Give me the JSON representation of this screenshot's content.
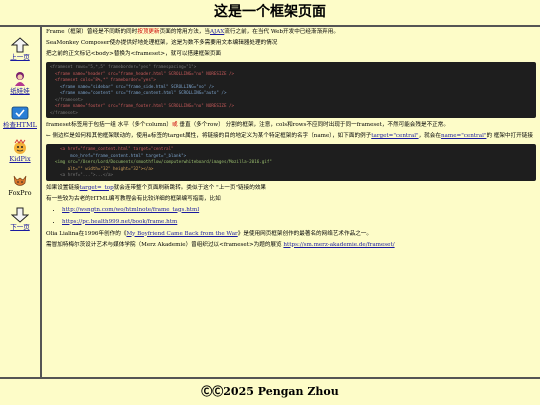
{
  "header": {
    "title": "这是一个框架页面"
  },
  "sidebar": {
    "items": [
      {
        "label": "上一页",
        "icon": "up-arrow-icon"
      },
      {
        "label": "纸娃娃",
        "icon": "paper-doll-icon"
      },
      {
        "label": "检查HTML",
        "icon": "html-check-icon"
      },
      {
        "label": "KidPix",
        "icon": "kidpix-icon"
      },
      {
        "label": "FoxPro",
        "icon": "foxpro-icon"
      },
      {
        "label": "下一页",
        "icon": "down-arrow-icon"
      }
    ]
  },
  "main": {
    "p1": {
      "a": "Frame（框架）曾经是不同断的同时",
      "red": "按顶更新",
      "b": "页面的常用方法，当",
      "link": "AJAX",
      "c": "流行之前，在当代 Web开发中已经渐渐弃用。"
    },
    "p2": "SeaMonkey Composer使办提供好地处理框架，这是为数不多需要用文本编辑器处理的情况",
    "p3": "把之前的正文标记<body>替换为<frameset>，就可以搭建框架页面",
    "code1": [
      "<frameset rows=\"5,*,5\" frameborder=\"yes\" framespacing=\"1\">",
      "  <frame name=\"header\" src=\"frame_header.html\" SCROLLING=\"no\" NORESIZE />",
      "  <frameset cols=\"8%,*\" frameborder=\"yes\">",
      "    <frame name=\"sidebar\" src=\"frame_side.html\" SCROLLING=\"no\" />",
      "    <frame name=\"content\" src=\"frame_content.html\" SCROLLING=\"auto\" />",
      "  </frameset>",
      "  <frame name=\"footer\" src=\"frame_footer.html\" SCROLLING=\"no\" NORESIZE />",
      "</frameset>"
    ],
    "p4": {
      "a": "frameset标签用于包括一组 水平（多个column）",
      "red": "或",
      "b": " 垂直（多个row） 分割的框架，注意，cols和rows不应同时出现于同一frameset，不然可能会残是不正常。"
    },
    "p5": {
      "a": "← 侧边栏是如何和其他框架联动的，使用a标签的target属性，将链接的目的地定义为某个特定框架的名字（name），如下面的例子",
      "link1": "target=\"central\"",
      "b": "，就会在",
      "link2": "name=\"central\"",
      "c": "的 框架中打开链接"
    },
    "code2": [
      "    <a href=\"frame_content.html\" target=\"central\"",
      "        mce_href=\"frame_content.html\" target=\"_blank\">",
      "  <img src=\"/Users/Lord/Documents/smoothflow/computerwhiteboard/images/Mozilla-2016.gif\"",
      "       alt=\"\" width=\"32\" height=\"32\"></a>",
      "    <a href=\"...\">...</a>"
    ],
    "p6": {
      "a": "如果设置链接",
      "link": "target=_top",
      "b": "就会连带整个页面刷新跳转。类似于这个 \"上一页\"链接的效果"
    },
    "p7": "有一些较为古老的HTML编写教程会有比较详细的框架编写指南，比如",
    "links": [
      "http://wsngtn.com/wo/htmlnote/frame_tags.html",
      "https://pc.health999.net/book/frame.htm"
    ],
    "p8": {
      "a": "Olia Lialina在1996年创作的《",
      "link": "My Boyfriend Came Back from the War",
      "b": "》是使用网页框架创作的最著名的网络艺术作品之一。"
    },
    "p9": {
      "a": "需冒加特梅尔茨设计艺术与媒体学院（Merz Akademie）曾组织过以<frameset>为题的展览 ",
      "link": "https://sm.merz-akademie.de/frameset/"
    }
  },
  "footer": {
    "text": "ⒸⒸ2025 Pengan Zhou"
  }
}
